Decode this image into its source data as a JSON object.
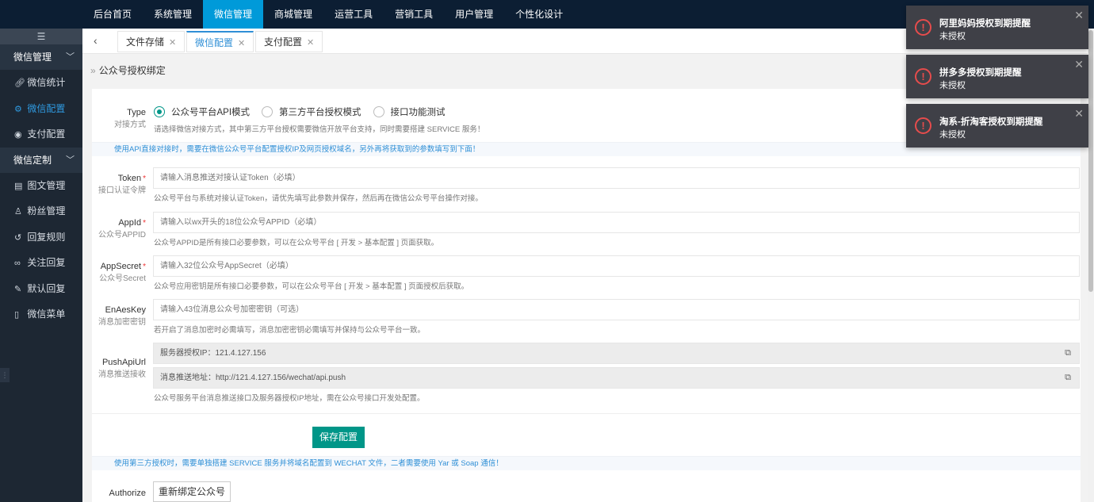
{
  "top_nav": [
    {
      "label": "后台首页",
      "active": false
    },
    {
      "label": "系统管理",
      "active": false
    },
    {
      "label": "微信管理",
      "active": true
    },
    {
      "label": "商城管理",
      "active": false
    },
    {
      "label": "运营工具",
      "active": false
    },
    {
      "label": "营销工具",
      "active": false
    },
    {
      "label": "用户管理",
      "active": false
    },
    {
      "label": "个性化设计",
      "active": false
    }
  ],
  "sidebar": {
    "collapse_icon": "☰",
    "groups": [
      {
        "label": "微信管理",
        "items": [
          {
            "label": "微信统计",
            "icon": "link-icon"
          },
          {
            "label": "微信配置",
            "icon": "gear-icon",
            "active": true
          },
          {
            "label": "支付配置",
            "icon": "pay-icon"
          }
        ]
      },
      {
        "label": "微信定制",
        "items": [
          {
            "label": "图文管理",
            "icon": "article-icon"
          },
          {
            "label": "粉丝管理",
            "icon": "user-icon"
          },
          {
            "label": "回复规则",
            "icon": "reply-icon"
          },
          {
            "label": "关注回复",
            "icon": "follow-icon"
          },
          {
            "label": "默认回复",
            "icon": "edit-icon"
          },
          {
            "label": "微信菜单",
            "icon": "phone-icon"
          }
        ]
      }
    ]
  },
  "tabs": [
    {
      "label": "文件存储",
      "active": false
    },
    {
      "label": "微信配置",
      "active": true
    },
    {
      "label": "支付配置",
      "active": false
    }
  ],
  "breadcrumb": "公众号授权绑定",
  "form": {
    "type": {
      "label": "Type",
      "sub": "对接方式",
      "options": [
        "公众号平台API模式",
        "第三方平台授权模式",
        "接口功能测试"
      ],
      "selected": "公众号平台API模式",
      "help": "请选择微信对接方式，其中第三方平台授权需要微信开放平台支持，同时需要搭建 SERVICE 服务！"
    },
    "api_notice": "使用API直接对接时，需要在微信公众号平台配置授权IP及网页授权域名，另外再将获取到的参数填写到下面！",
    "token": {
      "label": "Token",
      "sub": "接口认证令牌",
      "placeholder": "请输入消息推送对接认证Token（必填）",
      "help": "公众号平台与系统对接认证Token，请优先填写此参数并保存，然后再在微信公众号平台操作对接。"
    },
    "appid": {
      "label": "AppId",
      "sub": "公众号APPID",
      "placeholder": "请输入以wx开头的18位公众号APPID（必填）",
      "help": "公众号APPID是所有接口必要参数，可以在公众号平台 [ 开发 > 基本配置 ] 页面获取。"
    },
    "appsecret": {
      "label": "AppSecret",
      "sub": "公众号Secret",
      "placeholder": "请输入32位公众号AppSecret（必填）",
      "help": "公众号应用密钥是所有接口必要参数，可以在公众号平台 [ 开发 > 基本配置 ] 页面授权后获取。"
    },
    "enaeskey": {
      "label": "EnAesKey",
      "sub": "消息加密密钥",
      "placeholder": "请输入43位消息公众号加密密钥（可选）",
      "help": "若开启了消息加密时必需填写，消息加密密钥必需填写并保持与公众号平台一致。"
    },
    "pushapiurl": {
      "label": "PushApiUrl",
      "sub": "消息推送接收",
      "server_ip": "服务器授权IP：121.4.127.156",
      "push_url": "消息推送地址：http://121.4.127.156/wechat/api.push",
      "help": "公众号服务平台消息推送接口及服务器授权IP地址，需在公众号接口开发处配置。"
    },
    "save_label": "保存配置",
    "third_notice": "使用第三方授权时，需要单独搭建 SERVICE 服务并将域名配置到 WECHAT 文件，二者需要使用 Yar 或 Soap 通信！",
    "authorize": {
      "label": "Authorize",
      "button": "重新绑定公众号"
    }
  },
  "toasts": [
    {
      "title": "阿里妈妈授权到期提醒",
      "message": "未授权"
    },
    {
      "title": "拼多多授权到期提醒",
      "message": "未授权"
    },
    {
      "title": "淘系-折淘客授权到期提醒",
      "message": "未授权"
    }
  ],
  "colors": {
    "topbar": "#0c1e33",
    "nav_active": "#009ad9",
    "sidebar": "#1d2733",
    "primary_button": "#009688",
    "link_blue": "#2f8fd6",
    "toast_bg": "#3f4047",
    "error_red": "#e74c4c"
  }
}
